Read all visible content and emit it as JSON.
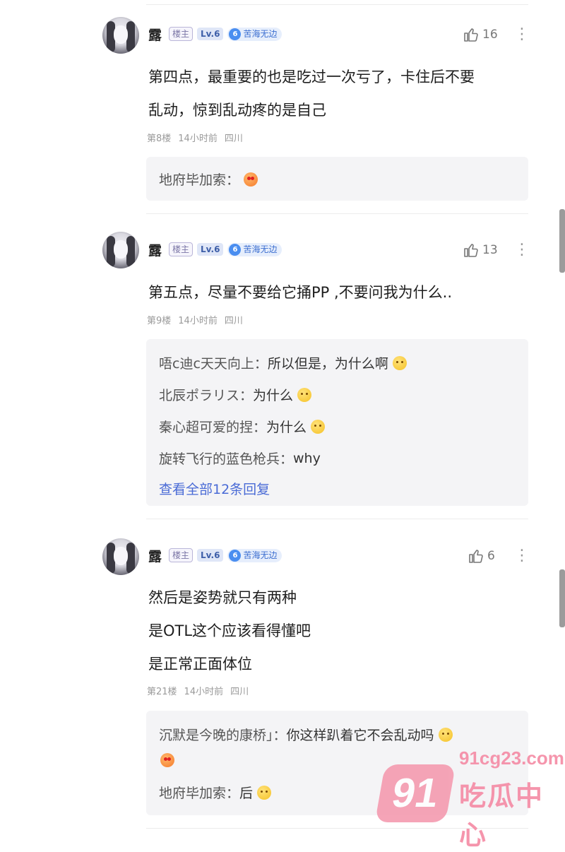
{
  "comments": [
    {
      "username": "露",
      "owner_badge": "楼主",
      "level": "Lv.6",
      "title_num": "6",
      "title_badge": "苦海无边",
      "likes": "16",
      "more": "⋮",
      "body": [
        "第四点，最重要的也是吃过一次亏了，卡住后不要",
        "乱动，惊到乱动疼的是自己"
      ],
      "floor": "第8楼",
      "time": "14小时前",
      "location": "四川",
      "replies": [
        {
          "who": "地府毕加索：",
          "text": "",
          "emoji": "love"
        }
      ],
      "view_all": ""
    },
    {
      "username": "露",
      "owner_badge": "楼主",
      "level": "Lv.6",
      "title_num": "6",
      "title_badge": "苦海无边",
      "likes": "13",
      "more": "⋮",
      "body": [
        "第五点，尽量不要给它捅PP ,不要问我为什么.."
      ],
      "floor": "第9楼",
      "time": "14小时前",
      "location": "四川",
      "replies": [
        {
          "who": "唔c迪c天天向上：",
          "text": "所以但是，为什么啊",
          "emoji": "face"
        },
        {
          "who": "北辰ポラリス：",
          "text": "为什么",
          "emoji": "face"
        },
        {
          "who": "秦心超可爱的捏：",
          "text": "为什么",
          "emoji": "face"
        },
        {
          "who": "旋转飞行的蓝色枪兵：",
          "text": "why",
          "emoji": ""
        }
      ],
      "view_all": "查看全部12条回复"
    },
    {
      "username": "露",
      "owner_badge": "楼主",
      "level": "Lv.6",
      "title_num": "6",
      "title_badge": "苦海无边",
      "likes": "6",
      "more": "⋮",
      "body": [
        "然后是姿势就只有两种",
        "是OTL这个应该看得懂吧",
        "是正常正面体位"
      ],
      "floor": "第21楼",
      "time": "14小时前",
      "location": "四川",
      "replies": [
        {
          "who": "沉默是今晚的康桥」：",
          "text": "你这样趴着它不会乱动吗",
          "emoji": "face"
        },
        {
          "who": "",
          "text": "",
          "emoji": "love"
        },
        {
          "who": "地府毕加索：",
          "text": "后",
          "emoji": "face"
        }
      ],
      "view_all": ""
    }
  ],
  "watermark": {
    "logo": "91",
    "url": "91cg23.com",
    "name": "吃瓜中心"
  }
}
